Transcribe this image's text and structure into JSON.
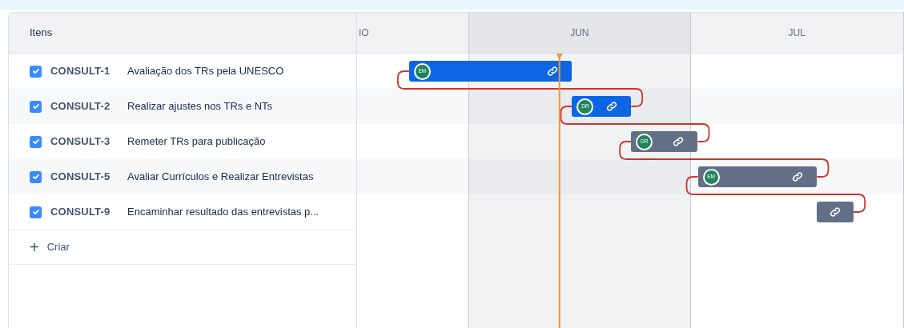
{
  "header": {
    "items_label": "Itens"
  },
  "months": [
    {
      "label": "IO",
      "selected": false
    },
    {
      "label": "JUN",
      "selected": true
    },
    {
      "label": "JUL",
      "selected": false
    }
  ],
  "items": [
    {
      "key": "CONSULT-1",
      "summary": "Avaliação dos TRs pela UNESCO",
      "checked": true,
      "bar": {
        "color": "#0c66e4",
        "avatar": "EM"
      }
    },
    {
      "key": "CONSULT-2",
      "summary": "Realizar ajustes nos TRs e NTs",
      "checked": true,
      "bar": {
        "color": "#0c66e4",
        "avatar": "DR"
      }
    },
    {
      "key": "CONSULT-3",
      "summary": "Remeter TRs para publicação",
      "checked": true,
      "bar": {
        "color": "#626f86",
        "avatar": "DR"
      }
    },
    {
      "key": "CONSULT-5",
      "summary": "Avaliar Currículos e Realizar Entrevistas",
      "checked": true,
      "bar": {
        "color": "#626f86",
        "avatar": "EM"
      }
    },
    {
      "key": "CONSULT-9",
      "summary": "Encaminhar resultado das entrevistas p...",
      "checked": true,
      "bar": {
        "color": "#626f86"
      }
    }
  ],
  "create": {
    "icon": "+",
    "label": "Criar"
  }
}
